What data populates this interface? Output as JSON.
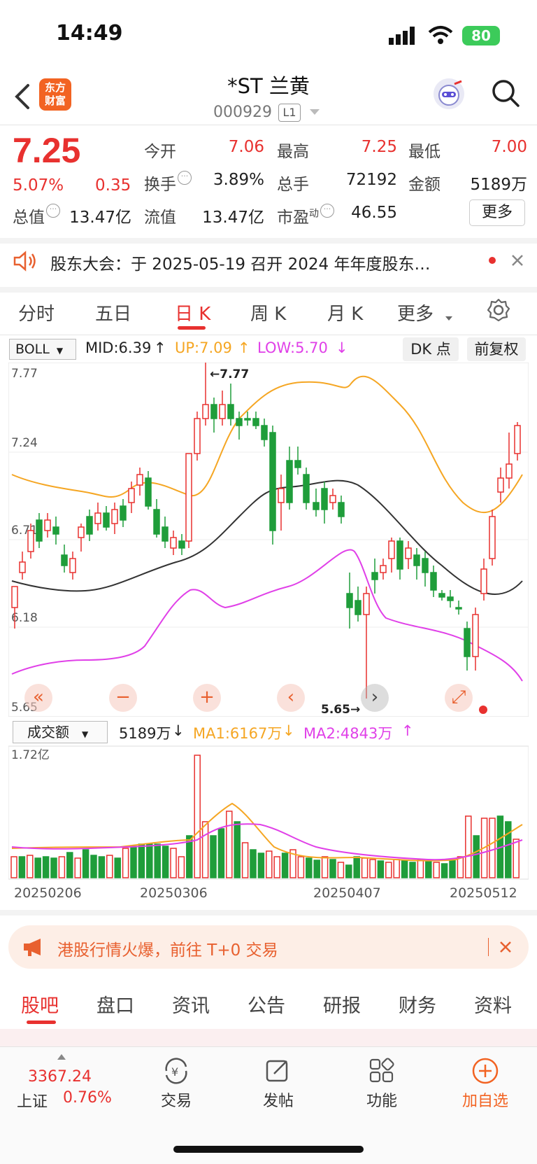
{
  "status_bar": {
    "time": "14:49",
    "battery": "80"
  },
  "header": {
    "logo_line1": "东方",
    "logo_line2": "财富",
    "stock_name": "*ST 兰黄",
    "stock_code": "000929",
    "board": "L1"
  },
  "quote": {
    "price": "7.25",
    "change_pct": "5.07%",
    "change": "0.35",
    "open_label": "今开",
    "open": "7.06",
    "high_label": "最高",
    "high": "7.25",
    "low_label": "最低",
    "low": "7.00",
    "turnover_label": "换手",
    "turnover": "3.89%",
    "volume_label": "总手",
    "volume": "72192",
    "amount_label": "金额",
    "amount": "5189万",
    "total_mv_label": "总值",
    "total_mv": "13.47亿",
    "float_mv_label": "流值",
    "float_mv": "13.47亿",
    "pe_label": "市盈",
    "pe_sup": "动",
    "pe": "46.55",
    "more_label": "更多"
  },
  "notice": {
    "text": "股东大会：于 2025-05-19 召开 2024 年年度股东…"
  },
  "period_tabs": [
    "分时",
    "五日",
    "日 K",
    "周 K",
    "月 K",
    "更多"
  ],
  "indicator": {
    "name": "BOLL",
    "mid": "MID:6.39",
    "up": "UP:7.09",
    "low": "LOW:5.70",
    "dk_label": "DK 点",
    "fq_label": "前复权"
  },
  "kline_axis": {
    "y_ticks": [
      "7.77",
      "7.24",
      "6.71",
      "6.18",
      "5.65"
    ],
    "max_label": "7.77",
    "min_label": "5.65"
  },
  "volume": {
    "indicator_name": "成交额",
    "current": "5189万",
    "ma1": "MA1:6167万",
    "ma2": "MA2:4843万",
    "y_top": "1.72亿"
  },
  "dates": [
    "20250206",
    "20250306",
    "20250407",
    "20250512"
  ],
  "promo": {
    "text": "港股行情火爆，前往 T+0 交易"
  },
  "bottom_tabs": [
    "股吧",
    "盘口",
    "资讯",
    "公告",
    "研报",
    "财务",
    "资料"
  ],
  "bottom_nav": {
    "index_value": "3367.24",
    "index_name": "上证",
    "index_pct": "0.76%",
    "trade": "交易",
    "post": "发帖",
    "functions": "功能",
    "add_watch": "加自选"
  },
  "colors": {
    "up": "#e8312f",
    "down": "#1f9d3a",
    "boll_up": "#f5a623",
    "boll_low": "#e040e8",
    "boll_mid": "#333333",
    "accent": "#f26322"
  }
}
